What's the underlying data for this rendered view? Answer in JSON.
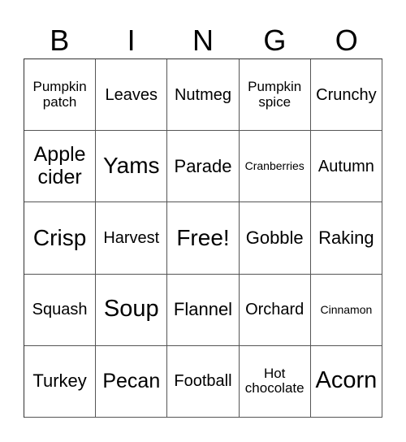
{
  "header": [
    "B",
    "I",
    "N",
    "G",
    "O"
  ],
  "cells": [
    [
      "Pumpkin patch",
      "Leaves",
      "Nutmeg",
      "Pumpkin spice",
      "Crunchy"
    ],
    [
      "Apple cider",
      "Yams",
      "Parade",
      "Cranberries",
      "Autumn"
    ],
    [
      "Crisp",
      "Harvest",
      "Free!",
      "Gobble",
      "Raking"
    ],
    [
      "Squash",
      "Soup",
      "Flannel",
      "Orchard",
      "Cinnamon"
    ],
    [
      "Turkey",
      "Pecan",
      "Football",
      "Hot chocolate",
      "Acorn"
    ]
  ]
}
